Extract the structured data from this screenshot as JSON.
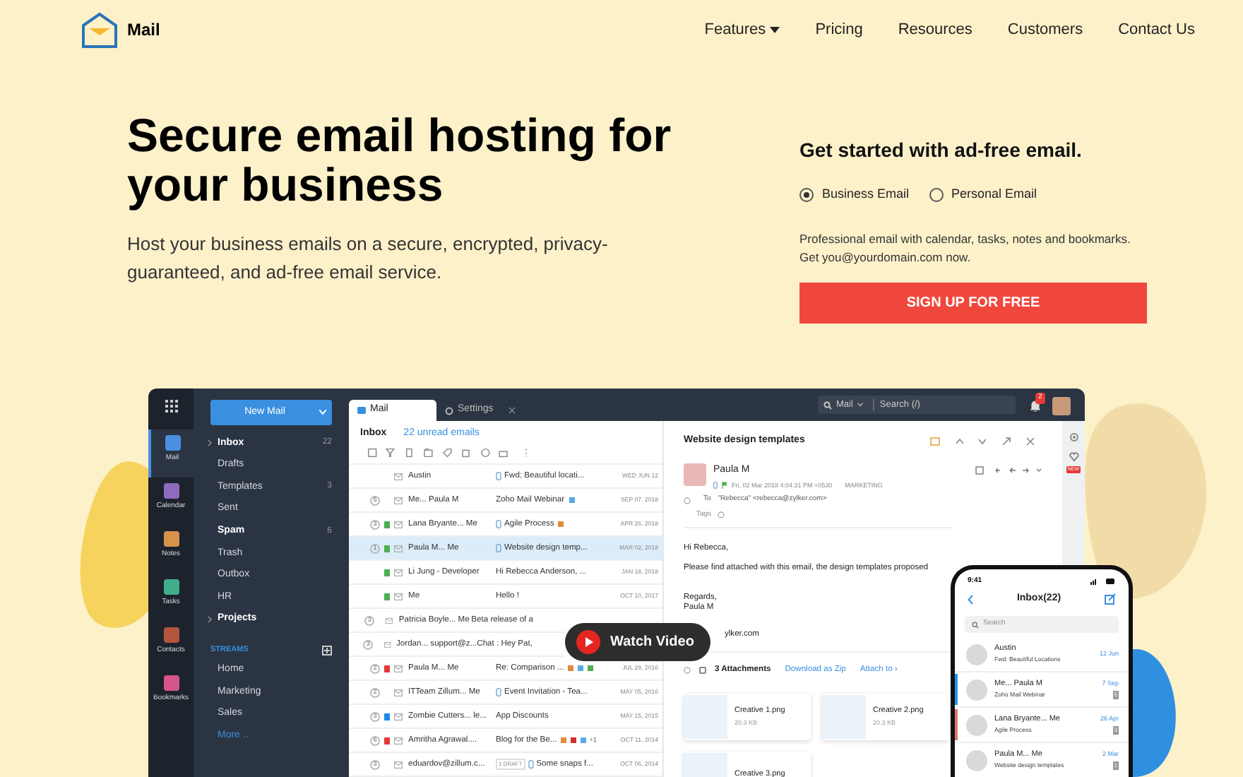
{
  "nav": {
    "brand": "Mail",
    "links": [
      {
        "label": "Features",
        "dropdown": true
      },
      {
        "label": "Pricing",
        "dropdown": false
      },
      {
        "label": "Resources",
        "dropdown": false
      },
      {
        "label": "Customers",
        "dropdown": false
      },
      {
        "label": "Contact Us",
        "dropdown": false
      }
    ]
  },
  "hero": {
    "title": "Secure email hosting for your business",
    "subtitle": "Host your business emails on a secure, encrypted, privacy-guaranteed, and ad-free email service."
  },
  "signup": {
    "heading": "Get started with ad-free email.",
    "options": [
      {
        "label": "Business Email",
        "selected": true
      },
      {
        "label": "Personal Email",
        "selected": false
      }
    ],
    "description": "Professional email with calendar, tasks, notes and bookmarks. Get you@yourdomain.com now.",
    "button": "SIGN UP FOR FREE"
  },
  "app": {
    "rail": [
      {
        "label": "Mail",
        "selected": true,
        "color": "#4a90e2"
      },
      {
        "label": "Calendar",
        "selected": false,
        "color": "#8e6bbf"
      },
      {
        "label": "Notes",
        "selected": false,
        "color": "#d9924a"
      },
      {
        "label": "Tasks",
        "selected": false,
        "color": "#3fae8a"
      },
      {
        "label": "Contacts",
        "selected": false,
        "color": "#b5553f"
      },
      {
        "label": "Bookmarks",
        "selected": false,
        "color": "#d6558a"
      }
    ],
    "new_mail": "New Mail",
    "folders": [
      {
        "label": "Inbox",
        "count": "22",
        "bold": true,
        "expandable": true
      },
      {
        "label": "Drafts",
        "bold": false,
        "expandable": false
      },
      {
        "label": "Templates",
        "count": "3",
        "bold": false,
        "expandable": false
      },
      {
        "label": "Sent",
        "bold": false,
        "expandable": false
      },
      {
        "label": "Spam",
        "count": "6",
        "bold": true,
        "expandable": false
      },
      {
        "label": "Trash",
        "bold": false,
        "expandable": false
      },
      {
        "label": "Outbox",
        "bold": false,
        "expandable": false
      },
      {
        "label": "HR",
        "bold": false,
        "expandable": false
      },
      {
        "label": "Projects",
        "bold": true,
        "expandable": true
      }
    ],
    "streams": {
      "heading": "STREAMS",
      "items": [
        "Home",
        "Marketing",
        "Sales"
      ],
      "more": "More .."
    },
    "tabs": [
      {
        "label": "Mail",
        "selected": true
      },
      {
        "label": "Settings",
        "selected": false
      }
    ],
    "search": {
      "scope": "Mail",
      "placeholder": "Search (/)"
    },
    "notifications": "2",
    "inbox": {
      "title": "Inbox",
      "unread": "22 unread emails"
    },
    "emails": [
      {
        "sender": "Austin",
        "attachment": true,
        "subject": "Fwd: Beautiful locati...",
        "date": "WED JUN 12",
        "selected": false
      },
      {
        "count": "5",
        "sender": "Me... Paula M",
        "attachment": false,
        "subject": "Zoho Mail Webinar",
        "tags": [
          {
            "color": "#5aa9e6"
          }
        ],
        "date": "SEP 07, 2018",
        "selected": false
      },
      {
        "count": "3",
        "flag": {
          "color": "#4caf50"
        },
        "sender": "Lana Bryante... Me",
        "attachment": true,
        "subject": "Agile Process",
        "tags": [
          {
            "color": "#e08a3c"
          }
        ],
        "date": "APR 26, 2018",
        "selected": false
      },
      {
        "count": "1",
        "flag": {
          "color": "#4caf50"
        },
        "sender": "Paula M... Me",
        "attachment": true,
        "subject": "Website design temp...",
        "date": "MAR 02, 2018",
        "selected": true
      },
      {
        "flag": {
          "color": "#4caf50"
        },
        "sender": "Li Jung - Developer",
        "attachment": false,
        "subject": "Hi Rebecca Anderson, ...",
        "date": "JAN 18, 2018",
        "selected": false
      },
      {
        "flag": {
          "color": "#4caf50"
        },
        "sender": "Me",
        "attachment": false,
        "subject": "Hello !",
        "date": "OCT 10, 2017",
        "selected": false
      },
      {
        "count": "3",
        "sender": "Patricia Boyle... Me",
        "attachment": false,
        "subject": "Beta release of a",
        "selected": false
      },
      {
        "count": "3",
        "sender": "Jordan... support@z...",
        "attachment": false,
        "subject": "Chat : Hey Pat,",
        "selected": false
      },
      {
        "count": "2",
        "flag": {
          "color": "#e53935"
        },
        "sender": "Paula M... Me",
        "attachment": false,
        "subject": "Re: Comparison ...",
        "tags": [
          {
            "color": "#e08a3c"
          },
          {
            "color": "#5aa9e6"
          },
          {
            "color": "#4caf50"
          }
        ],
        "date": "JUL 29, 2016",
        "selected": false
      },
      {
        "count": "2",
        "sender": "ITTeam Zillum... Me",
        "attachment": true,
        "subject": "Event Invitation - Tea...",
        "date": "MAY 05, 2016",
        "selected": false
      },
      {
        "count": "3",
        "flag": {
          "color": "#1e88e5"
        },
        "sender": "Zombie Cutters... le...",
        "attachment": false,
        "subject": "App Discounts",
        "date": "MAY 15, 2015",
        "selected": false
      },
      {
        "count": "6",
        "flag": {
          "color": "#e53935"
        },
        "sender": "Amritha Agrawal....",
        "attachment": false,
        "subject": "Blog for the Be...",
        "tags": [
          {
            "color": "#e08a3c"
          },
          {
            "color": "#d32f2f"
          },
          {
            "color": "#5aa9e6"
          }
        ],
        "more_tags": "+1",
        "date": "OCT 11, 2014",
        "selected": false
      },
      {
        "count": "3",
        "sender": "eduardov@zillum.c...",
        "draft": "1 DRAFT",
        "attachment": true,
        "subject": "Some snaps f...",
        "date": "OCT 06, 2014",
        "selected": false
      }
    ],
    "reader": {
      "subject": "Website design templates",
      "sender": "Paula M",
      "datetime": "Fri, 02 Mar 2018 4:04:31 PM +0530",
      "label": "MARKETING",
      "to_label": "To",
      "to": "\"Rebecca\" <rebecca@zylker.com>",
      "tags_label": "Tags",
      "new_badge": "NEW",
      "greeting": "Hi Rebecca,",
      "body": "Please find attached with this email, the design templates proposed",
      "sign_off": "Regards,",
      "signature": "Paula M",
      "link": "ylker.com",
      "attachments_checked": false,
      "attachments_title": "3 Attachments",
      "download": "Download as Zip",
      "attach_to": "Attach to ›",
      "attachments": [
        {
          "name": "Creative 1.png",
          "size": "20.3 KB"
        },
        {
          "name": "Creative 2.png",
          "size": "20.3 KB"
        },
        {
          "name": "Creative 3.png"
        }
      ]
    }
  },
  "video": {
    "label": "Watch Video"
  },
  "phone": {
    "time": "9:41",
    "title": "Inbox(22)",
    "search": "Search",
    "items": [
      {
        "sender": "Austin",
        "subject": "Fwd: Beautiful Locations",
        "date": "12 Jun"
      },
      {
        "sender": "Me... Paula M",
        "subject": "Zoho Mail Webinar",
        "date": "7 Sep",
        "count": "5",
        "color": "#2196f3"
      },
      {
        "sender": "Lana Bryante... Me",
        "subject": "Agile Process",
        "date": "26 Apr",
        "count": "3",
        "color": "#e57373"
      },
      {
        "sender": "Paula M... Me",
        "subject": "Website design templates",
        "date": "2 Mar",
        "count": "1"
      }
    ]
  }
}
